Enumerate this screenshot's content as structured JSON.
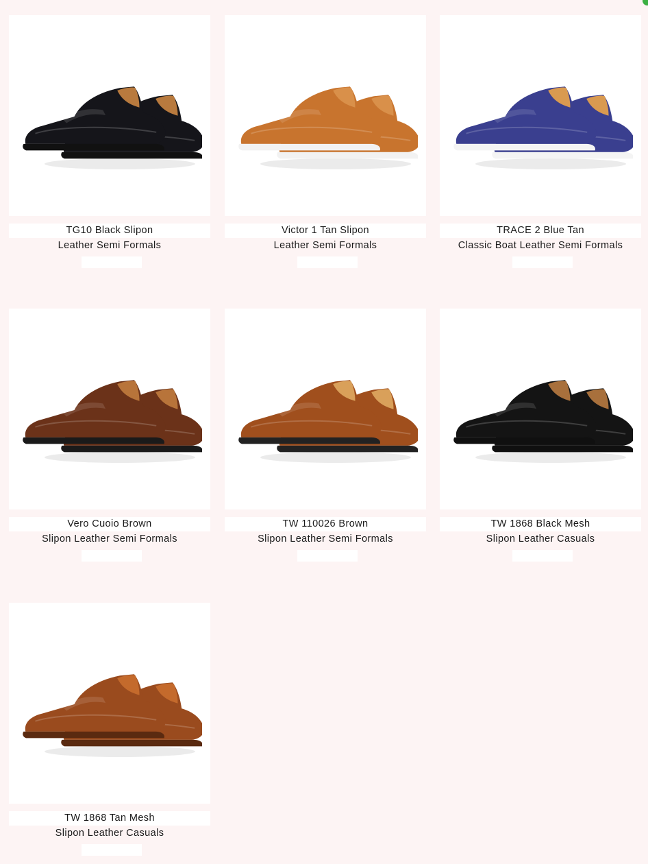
{
  "products": [
    {
      "name": "TG10 Black Slipon",
      "subtitle": "Leather Semi Formals",
      "color_upper": "#15151a",
      "color_lining": "#b87a3e",
      "color_sole": "#111111",
      "icon": "black-loafer-image"
    },
    {
      "name": "Victor 1 Tan Slipon",
      "subtitle": "Leather Semi Formals",
      "color_upper": "#c8742e",
      "color_lining": "#d9904a",
      "color_sole": "#f2f2f2",
      "icon": "tan-woven-loafer-image"
    },
    {
      "name": "TRACE 2 Blue Tan",
      "subtitle": "Classic Boat Leather Semi Formals",
      "color_upper": "#3a3f8f",
      "color_lining": "#d99a50",
      "color_sole": "#f4f4f4",
      "icon": "blue-boat-shoe-image"
    },
    {
      "name": "Vero Cuoio Brown",
      "subtitle": "Slipon Leather Semi Formals",
      "color_upper": "#6b3219",
      "color_lining": "#b8743a",
      "color_sole": "#1a1a1a",
      "icon": "brown-woven-loafer-image"
    },
    {
      "name": "TW 110026 Brown",
      "subtitle": "Slipon Leather Semi Formals",
      "color_upper": "#a04f1d",
      "color_lining": "#d9a05a",
      "color_sole": "#222222",
      "icon": "brown-brogue-slipon-image"
    },
    {
      "name": "TW 1868 Black Mesh",
      "subtitle": "Slipon Leather Casuals",
      "color_upper": "#141414",
      "color_lining": "#a8703c",
      "color_sole": "#101010",
      "icon": "black-mesh-loafer-image"
    },
    {
      "name": "TW 1868 Tan Mesh",
      "subtitle": "Slipon Leather Casuals",
      "color_upper": "#9a4b1e",
      "color_lining": "#c46a2c",
      "color_sole": "#5a2a10",
      "icon": "tan-mesh-loafer-image"
    }
  ]
}
